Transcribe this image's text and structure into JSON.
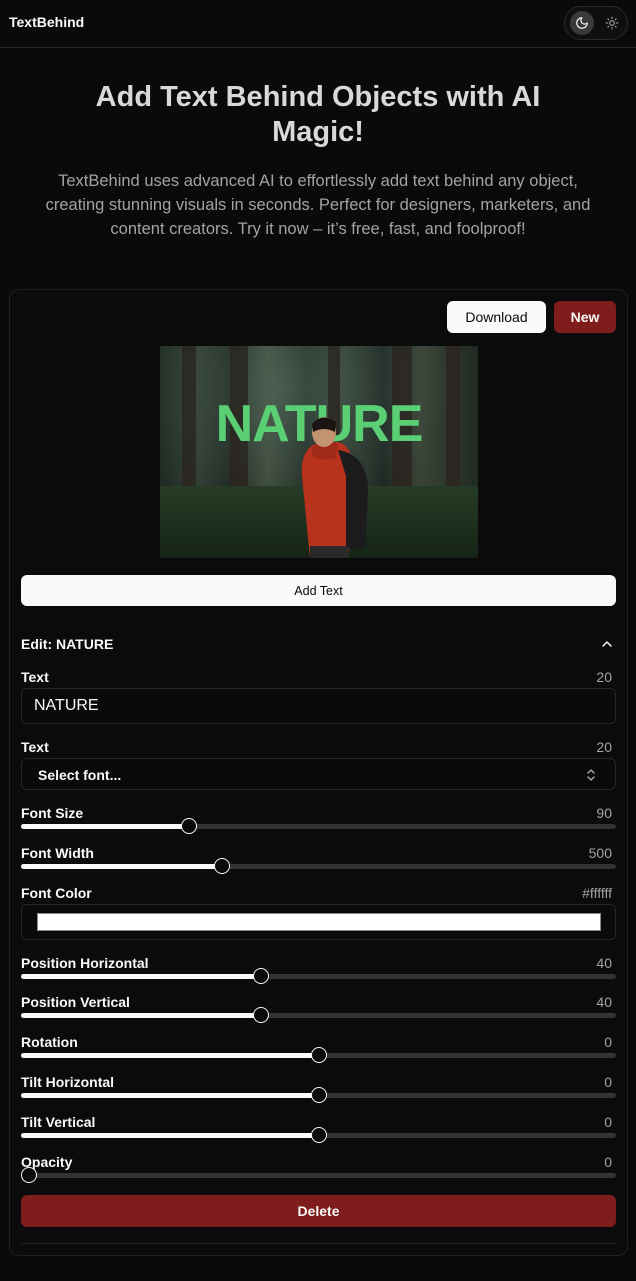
{
  "app": {
    "brand": "TextBehind",
    "theme": {
      "dark_icon": "moon-icon",
      "light_icon": "sun-icon",
      "selected": "dark"
    }
  },
  "hero": {
    "title": "Add Text Behind Objects with AI Magic!",
    "description": "TextBehind uses advanced AI to effortlessly add text behind any object, creating stunning visuals in seconds. Perfect for designers, marketers, and content creators. Try it now – it’s free, fast, and foolproof!"
  },
  "editor": {
    "download_label": "Download",
    "new_label": "New",
    "preview_text": "NATURE",
    "preview_text_color": "#5bcf73",
    "add_text_label": "Add Text",
    "edit_header": "Edit: NATURE",
    "fields": {
      "text_label": "Text",
      "text_count": "20",
      "text_value": "NATURE",
      "font_label": "Text",
      "font_count": "20",
      "font_placeholder": "Select font...",
      "color_label": "Font Color",
      "color_value": "#ffffff"
    },
    "sliders": [
      {
        "label": "Font Size",
        "value": "90",
        "fraction": 0.282
      },
      {
        "label": "Font Width",
        "value": "500",
        "fraction": 0.337
      },
      {
        "label": "Position Horizontal",
        "value": "40",
        "fraction": 0.403
      },
      {
        "label": "Position Vertical",
        "value": "40",
        "fraction": 0.403
      },
      {
        "label": "Rotation",
        "value": "0",
        "fraction": 0.5
      },
      {
        "label": "Tilt Horizontal",
        "value": "0",
        "fraction": 0.5
      },
      {
        "label": "Tilt Vertical",
        "value": "0",
        "fraction": 0.5
      },
      {
        "label": "Opacity",
        "value": "0",
        "fraction": 0.0
      }
    ],
    "delete_label": "Delete"
  }
}
